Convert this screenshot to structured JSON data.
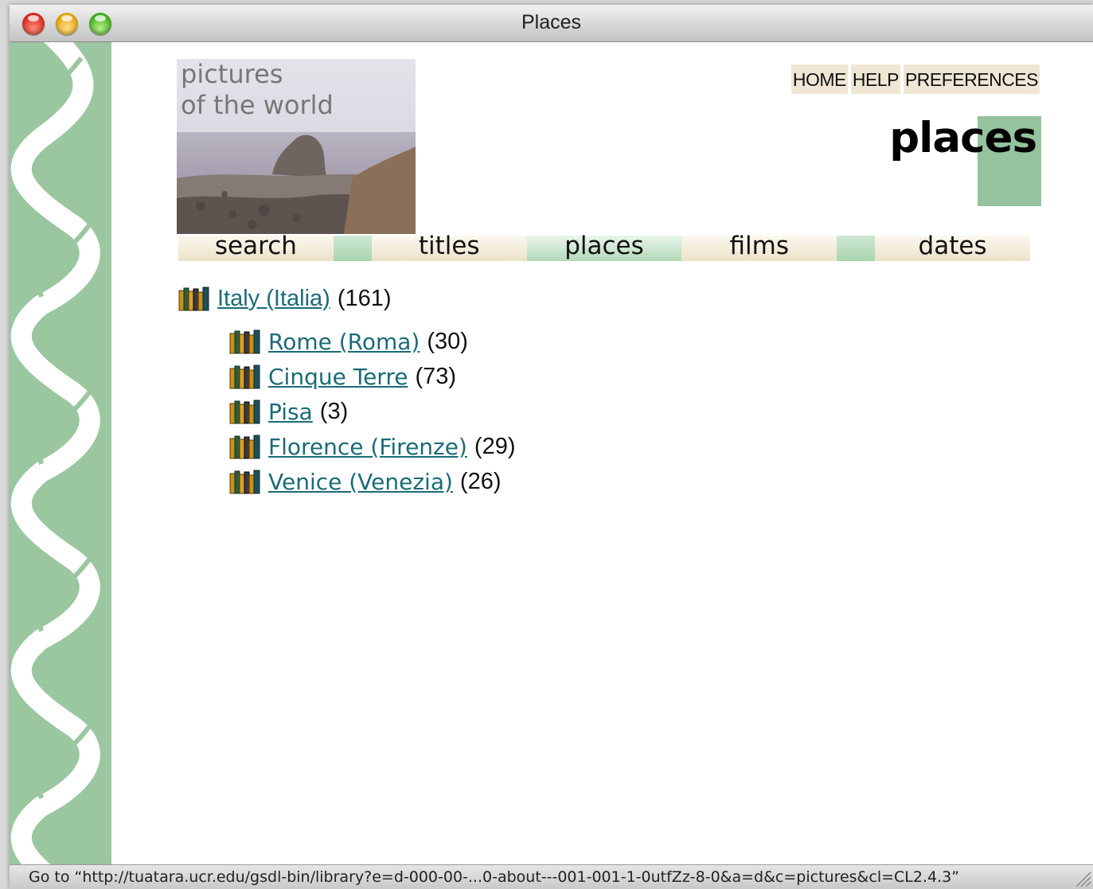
{
  "window": {
    "title": "Places"
  },
  "header": {
    "logo_line1": "pictures",
    "logo_line2": "of the world",
    "links": [
      "HOME",
      "HELP",
      "PREFERENCES"
    ],
    "page_heading": "places"
  },
  "nav": {
    "tabs": [
      {
        "label": "search",
        "active": false
      },
      {
        "label": "titles",
        "active": false
      },
      {
        "label": "places",
        "active": true
      },
      {
        "label": "films",
        "active": false
      },
      {
        "label": "dates",
        "active": false
      }
    ]
  },
  "tree": {
    "root": {
      "label": "Italy (Italia)",
      "count": "(161)"
    },
    "children": [
      {
        "label": "Rome (Roma)",
        "count": "(30)"
      },
      {
        "label": "Cinque Terre",
        "count": "(73)"
      },
      {
        "label": "Pisa",
        "count": "(3)"
      },
      {
        "label": "Florence (Firenze)",
        "count": "(29)"
      },
      {
        "label": "Venice (Venezia)",
        "count": "(26)"
      }
    ]
  },
  "status": {
    "text": "Go to “http://tuatara.ucr.edu/gsdl-bin/library?e=d-000-00-...0-about---001-001-1-0utfZz-8-0&a=d&c=pictures&cl=CL2.4.3”"
  },
  "icons": {
    "close": "close-button-icon",
    "minimize": "minimize-button-icon",
    "zoom": "zoom-button-icon",
    "bookshelf": "bookshelf-icon",
    "resize": "resize-grip-icon"
  },
  "colors": {
    "sidebar_green": "#9ac79f",
    "link_teal": "#1a6b77",
    "tab_beige": "#ece2c9",
    "tab_green": "#b3d9b8"
  }
}
